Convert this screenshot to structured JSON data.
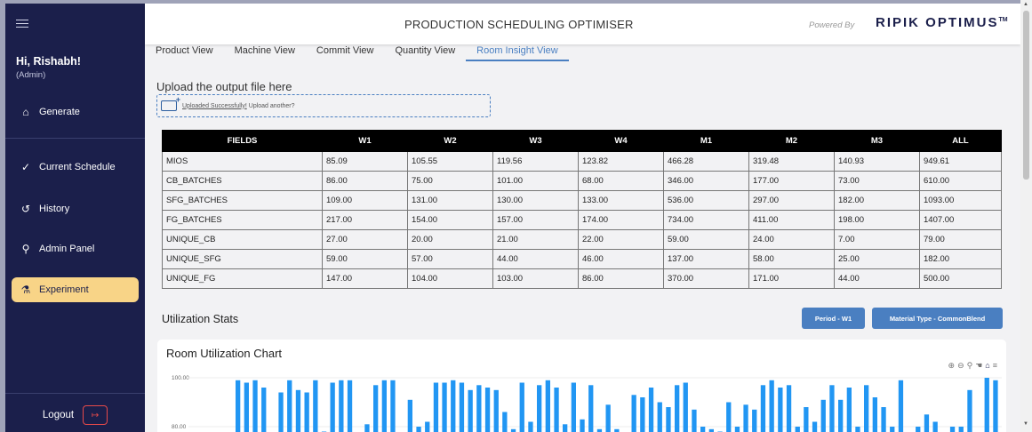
{
  "sidebar": {
    "greeting": "Hi, Rishabh!",
    "role": "(Admin)",
    "items": [
      {
        "label": "Generate",
        "icon": "home-icon",
        "glyph": "⌂"
      },
      {
        "label": "Current Schedule",
        "icon": "check-icon",
        "glyph": "✓"
      },
      {
        "label": "History",
        "icon": "history-icon",
        "glyph": "↺"
      },
      {
        "label": "Admin Panel",
        "icon": "user-key-icon",
        "glyph": "⚲"
      },
      {
        "label": "Experiment",
        "icon": "flask-icon",
        "glyph": "⚗"
      }
    ],
    "logout_label": "Logout",
    "logout_glyph": "↦"
  },
  "header": {
    "title": "PRODUCTION SCHEDULING OPTIMISER",
    "powered_by": "Powered By",
    "brand": "RIPIK OPTIMUS",
    "brand_tm": "TM"
  },
  "tabs": [
    {
      "label": "Product View"
    },
    {
      "label": "Machine View"
    },
    {
      "label": "Commit View"
    },
    {
      "label": "Quantity View"
    },
    {
      "label": "Room Insight View"
    }
  ],
  "upload": {
    "title": "Upload the output file here",
    "link_text": "Uploaded Successfully!",
    "after_text": "Upload another?"
  },
  "table": {
    "headers": [
      "FIELDS",
      "W1",
      "W2",
      "W3",
      "W4",
      "M1",
      "M2",
      "M3",
      "ALL"
    ],
    "rows": [
      [
        "MIOS",
        "85.09",
        "105.55",
        "119.56",
        "123.82",
        "466.28",
        "319.48",
        "140.93",
        "949.61"
      ],
      [
        "CB_BATCHES",
        "86.00",
        "75.00",
        "101.00",
        "68.00",
        "346.00",
        "177.00",
        "73.00",
        "610.00"
      ],
      [
        "SFG_BATCHES",
        "109.00",
        "131.00",
        "130.00",
        "133.00",
        "536.00",
        "297.00",
        "182.00",
        "1093.00"
      ],
      [
        "FG_BATCHES",
        "217.00",
        "154.00",
        "157.00",
        "174.00",
        "734.00",
        "411.00",
        "198.00",
        "1407.00"
      ],
      [
        "UNIQUE_CB",
        "27.00",
        "20.00",
        "21.00",
        "22.00",
        "59.00",
        "24.00",
        "7.00",
        "79.00"
      ],
      [
        "UNIQUE_SFG",
        "59.00",
        "57.00",
        "44.00",
        "46.00",
        "137.00",
        "58.00",
        "25.00",
        "182.00"
      ],
      [
        "UNIQUE_FG",
        "147.00",
        "104.00",
        "103.00",
        "86.00",
        "370.00",
        "171.00",
        "44.00",
        "500.00"
      ]
    ]
  },
  "utilization": {
    "title": "Utilization Stats",
    "period_button": "Period - W1",
    "material_button": "Material Type - CommonBlend"
  },
  "chart_data": {
    "type": "bar",
    "title": "Room Utilization Chart",
    "ylim": [
      75,
      100
    ],
    "yticks": [
      "100.00",
      "80.00"
    ],
    "color": "#2196f3",
    "values": [
      99,
      98,
      99,
      96,
      76,
      94,
      99,
      95,
      94,
      99,
      78,
      98,
      99,
      99,
      76,
      81,
      97,
      99,
      99,
      77,
      91,
      80,
      82,
      98,
      98,
      99,
      98,
      95,
      97,
      96,
      95,
      86,
      79,
      98,
      82,
      97,
      99,
      96,
      81,
      98,
      83,
      97,
      79,
      89,
      79,
      76,
      93,
      92,
      96,
      90,
      88,
      97,
      98,
      87,
      80,
      79,
      78,
      90,
      80,
      89,
      87,
      97,
      99,
      96,
      97,
      80,
      88,
      82,
      91,
      97,
      91,
      96,
      80,
      97,
      92,
      88,
      80,
      99,
      76,
      80,
      85,
      82,
      77,
      80,
      80,
      95,
      77,
      100,
      99
    ]
  }
}
